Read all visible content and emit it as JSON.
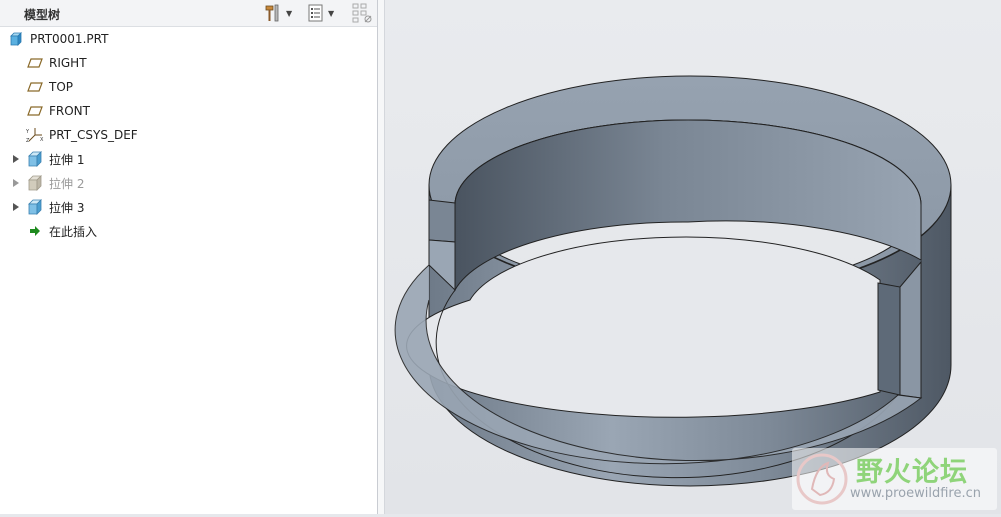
{
  "model_tree": {
    "title": "模型树",
    "items": [
      {
        "label": "PRT0001.PRT",
        "icon": "part-icon"
      },
      {
        "label": "RIGHT",
        "icon": "datum-plane-icon"
      },
      {
        "label": "TOP",
        "icon": "datum-plane-icon"
      },
      {
        "label": "FRONT",
        "icon": "datum-plane-icon"
      },
      {
        "label": "PRT_CSYS_DEF",
        "icon": "coordinate-system-icon"
      },
      {
        "label": "拉伸 1",
        "icon": "extrude-icon",
        "expandable": true
      },
      {
        "label": "拉伸 2",
        "icon": "extrude-suppressed-icon",
        "expandable": true,
        "dimmed": true
      },
      {
        "label": "拉伸 3",
        "icon": "extrude-icon",
        "expandable": true
      },
      {
        "label": "在此插入",
        "icon": "insert-here-arrow-icon"
      }
    ]
  },
  "toolbar": {
    "settings_icon": "hammer-tools-icon",
    "show_icon": "tree-filter-list-icon",
    "layer_icon": "layer-tree-icon"
  },
  "watermark": {
    "title": "野火论坛",
    "url": "www.proewildfire.cn"
  },
  "colors": {
    "accent_green": "#1e8a1e",
    "model_gray": "#8a96a4",
    "viewport_bg": "#e6e8ec"
  }
}
